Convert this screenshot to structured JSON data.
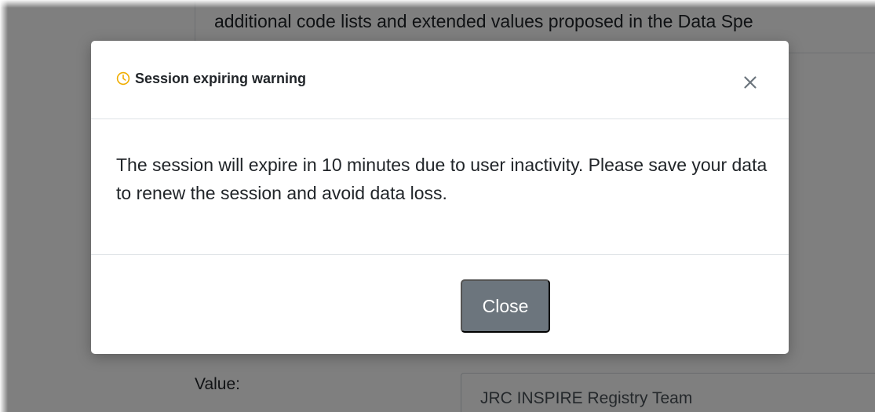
{
  "background": {
    "description_text": "additional code lists and extended values proposed in the Data Spe",
    "value_label": "Value:",
    "value_text": "JRC INSPIRE Registry Team"
  },
  "modal": {
    "icon": "clock-icon",
    "title": "Session expiring warning",
    "close_symbol": "×",
    "message": "The session will expire in 10 minutes due to user inactivity. Please save your data to renew the session and avoid data loss.",
    "button_label": "Close"
  },
  "colors": {
    "clock_icon": "#f0ad00",
    "close_button": "#6c757d",
    "overlay": "rgba(0,0,0,0.5)",
    "modal_bg": "#ffffff"
  }
}
